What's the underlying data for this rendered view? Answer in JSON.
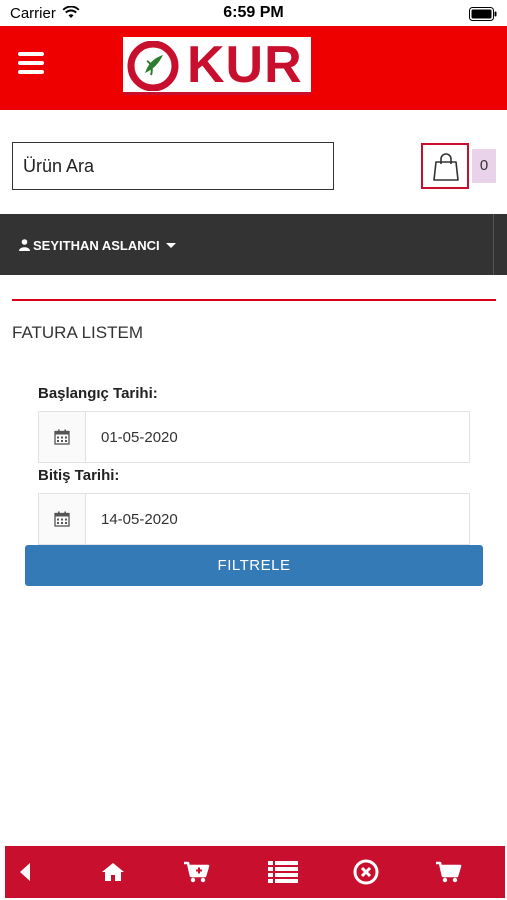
{
  "status_bar": {
    "carrier": "Carrier",
    "time": "6:59 PM"
  },
  "header": {
    "logo_text": "KUR",
    "brand_color": "#ee0000"
  },
  "search": {
    "placeholder": "Ürün Ara"
  },
  "cart": {
    "count": "0"
  },
  "user_menu": {
    "name": "SEYITHAN ASLANCI"
  },
  "page": {
    "title": "FATURA LISTEM"
  },
  "filter_form": {
    "start_label": "Başlangıç Tarihi:",
    "start_value": "01-05-2020",
    "end_label": "Bitiş Tarihi:",
    "end_value": "14-05-2020",
    "submit_label": "FILTRELE"
  },
  "bottom_nav": {
    "color": "#c8102e",
    "items": [
      "back-icon",
      "home-icon",
      "cart-plus-icon",
      "list-icon",
      "cancel-icon",
      "shopping-cart-icon"
    ]
  },
  "colors": {
    "accent": "#337ab7",
    "dark_bar": "#333333",
    "badge_bg": "#e9d3ea"
  }
}
